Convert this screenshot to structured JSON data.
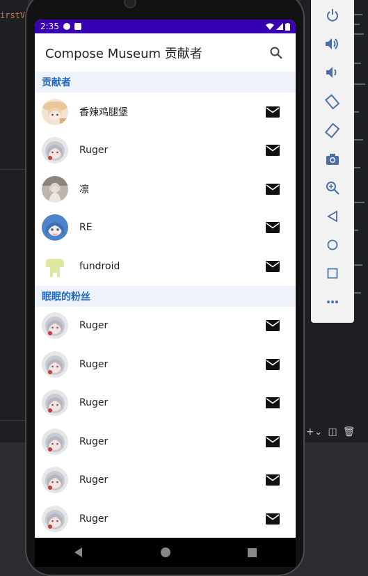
{
  "ide": {
    "code_fragment": "irstV"
  },
  "status_bar": {
    "time": "2:35"
  },
  "app_bar": {
    "title": "Compose Museum 贡献者",
    "search_icon": "search-icon"
  },
  "sections": [
    {
      "title": "贡献者",
      "items": [
        {
          "name": "香辣鸡腿堡",
          "avatar": "anime-girl-hat"
        },
        {
          "name": "Ruger",
          "avatar": "silver-hair-girl"
        },
        {
          "name": "凛",
          "avatar": "grey-figure"
        },
        {
          "name": "RE",
          "avatar": "blue-hair-girl"
        },
        {
          "name": "fundroid",
          "avatar": "android-logo"
        }
      ]
    },
    {
      "title": "眠眠的粉丝",
      "items": [
        {
          "name": "Ruger",
          "avatar": "silver-hair-girl"
        },
        {
          "name": "Ruger",
          "avatar": "silver-hair-girl"
        },
        {
          "name": "Ruger",
          "avatar": "silver-hair-girl"
        },
        {
          "name": "Ruger",
          "avatar": "silver-hair-girl"
        },
        {
          "name": "Ruger",
          "avatar": "silver-hair-girl"
        },
        {
          "name": "Ruger",
          "avatar": "silver-hair-girl"
        }
      ]
    }
  ],
  "colors": {
    "status_bar": "#3700b3",
    "section_header_bg": "#eef3fb",
    "section_header_text": "#2068c0"
  },
  "emulator_controls": [
    "power-icon",
    "volume-up-icon",
    "volume-down-icon",
    "rotate-left-icon",
    "rotate-right-icon",
    "camera-icon",
    "zoom-icon",
    "back-icon",
    "home-icon",
    "overview-icon",
    "more-icon"
  ]
}
